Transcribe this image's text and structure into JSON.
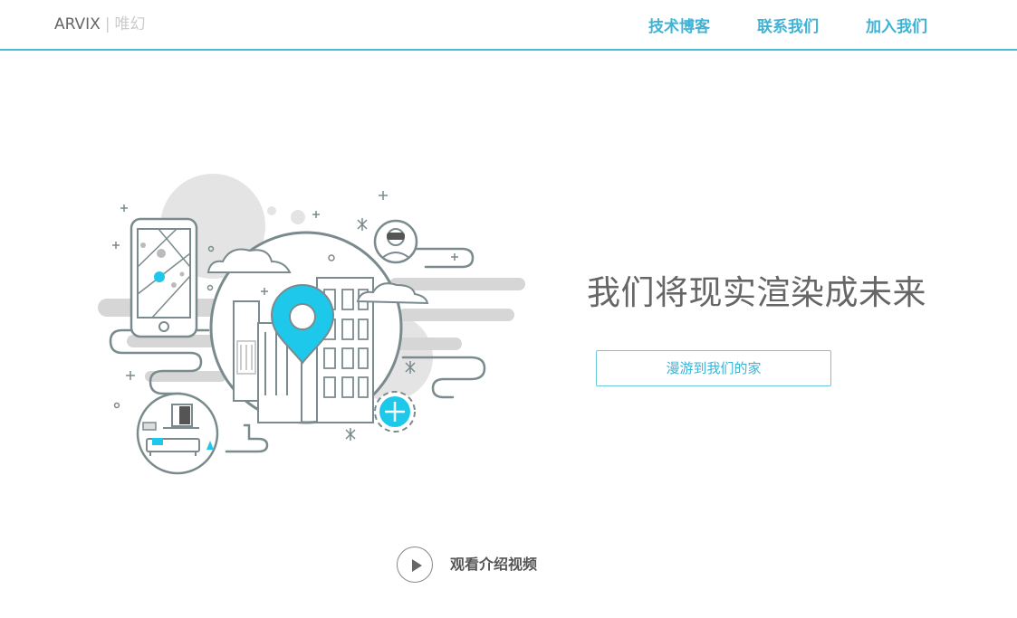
{
  "header": {
    "brand": "ARVIX",
    "separator": "|",
    "brand_cn": "唯幻",
    "nav": [
      {
        "label": "技术博客"
      },
      {
        "label": "联系我们"
      },
      {
        "label": "加入我们"
      }
    ]
  },
  "hero": {
    "headline": "我们将现实渲染成未来",
    "cta_label": "漫游到我们的家"
  },
  "video": {
    "label": "观看介绍视频"
  },
  "colors": {
    "accent": "#3fb3d5",
    "pin": "#1ec8ea",
    "line": "#7a8a8d",
    "shadow": "#d9d9d9",
    "text": "#666666"
  }
}
